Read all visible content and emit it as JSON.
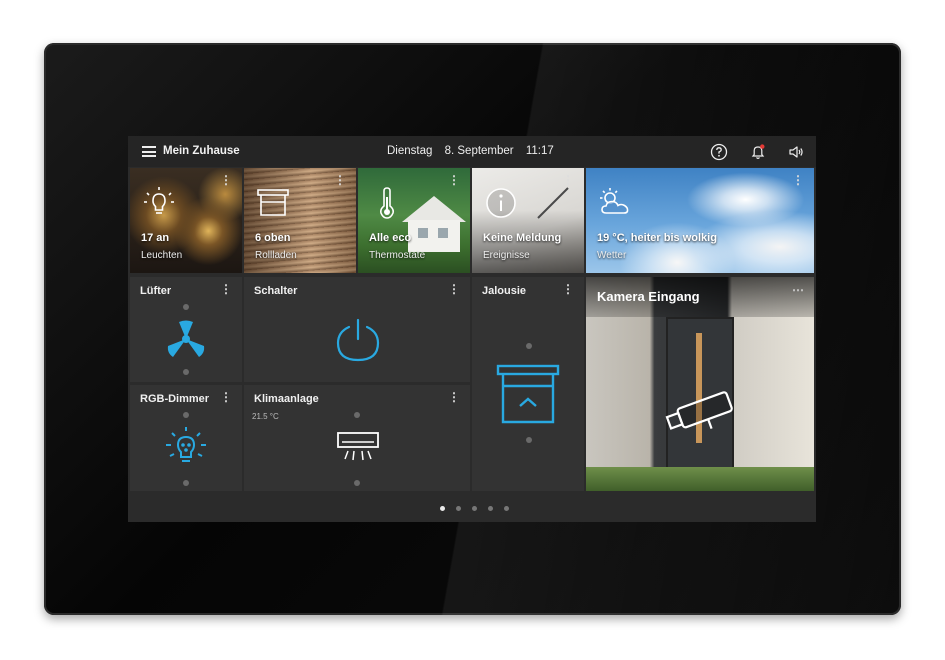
{
  "header": {
    "title": "Mein Zuhause",
    "weekday": "Dienstag",
    "date": "8. September",
    "time": "11:17",
    "icons": [
      "menu-icon",
      "help-icon",
      "bell-icon",
      "speaker-icon"
    ],
    "notification_color": "#e53935"
  },
  "photo_tiles": [
    {
      "value": "17 an",
      "label": "Leuchten",
      "icon": "lightbulb-icon"
    },
    {
      "value": "6 oben",
      "label": "Rollladen",
      "icon": "shutter-icon"
    },
    {
      "value": "Alle eco",
      "label": "Thermostate",
      "icon": "thermometer-icon"
    },
    {
      "value": "Keine Meldung",
      "label": "Ereignisse",
      "icon": "info-icon"
    },
    {
      "value": "19 °C, heiter bis wolkig",
      "label": "Wetter",
      "icon": "weather-icon"
    }
  ],
  "control_tiles": {
    "fan": {
      "title": "Lüfter",
      "icon": "fan-icon"
    },
    "switch": {
      "title": "Schalter",
      "icon": "power-icon"
    },
    "blind": {
      "title": "Jalousie",
      "icon": "blind-icon"
    },
    "dimmer": {
      "title": "RGB-Dimmer",
      "icon": "bulb-icon"
    },
    "ac": {
      "title": "Klimaanlage",
      "subtitle": "21.5 °C",
      "icon": "air-conditioner-icon"
    }
  },
  "camera": {
    "title": "Kamera Eingang",
    "icon": "camera-icon"
  },
  "pagination": {
    "pages": 5,
    "active": 1
  },
  "colors": {
    "accent": "#29a9e1",
    "tile": "#333333",
    "screen": "#2b2b2b",
    "bar": "#252525"
  }
}
